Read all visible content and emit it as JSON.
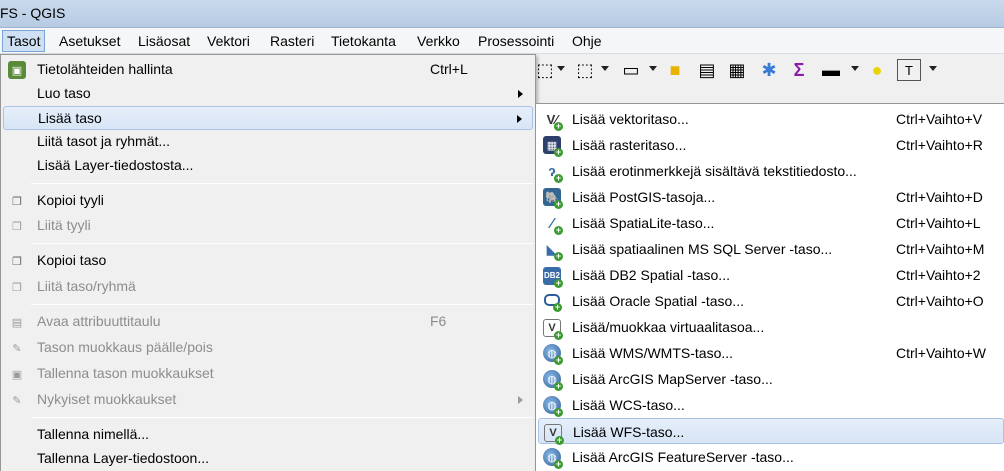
{
  "window": {
    "title": "FS - QGIS"
  },
  "menubar": {
    "items": [
      {
        "label": "Tasot",
        "active": true
      },
      {
        "label": "Asetukset"
      },
      {
        "label": "Lisäosat"
      },
      {
        "label": "Vektori"
      },
      {
        "label": "Rasteri"
      },
      {
        "label": "Tietokanta"
      },
      {
        "label": "Verkko"
      },
      {
        "label": "Prosessointi"
      },
      {
        "label": "Ohje"
      }
    ]
  },
  "main_menu": {
    "items": [
      {
        "label": "Tietolähteiden hallinta",
        "shortcut": "Ctrl+L",
        "icon": "data-source-manager-icon"
      },
      {
        "label": "Luo taso",
        "submenu": true
      },
      {
        "label": "Lisää taso",
        "submenu": true,
        "highlighted": true
      },
      {
        "label": "Liitä tasot ja ryhmät..."
      },
      {
        "label": "Lisää Layer-tiedostosta..."
      },
      {
        "label": "Kopioi tyyli",
        "icon": "copy-style-icon"
      },
      {
        "label": "Liitä tyyli",
        "disabled": true,
        "icon": "paste-style-icon"
      },
      {
        "label": "Kopioi taso",
        "icon": "copy-layer-icon"
      },
      {
        "label": "Liitä taso/ryhmä",
        "disabled": true,
        "icon": "paste-layer-icon"
      },
      {
        "label": "Avaa attribuuttitaulu",
        "shortcut": "F6",
        "disabled": true,
        "icon": "attribute-table-icon"
      },
      {
        "label": "Tason muokkaus päälle/pois",
        "disabled": true,
        "icon": "pencil-icon"
      },
      {
        "label": "Tallenna tason muokkaukset",
        "disabled": true,
        "icon": "save-edits-icon"
      },
      {
        "label": "Nykyiset muokkaukset",
        "disabled": true,
        "submenu": true,
        "icon": "current-edits-icon"
      },
      {
        "label": "Tallenna nimellä..."
      },
      {
        "label": "Tallenna Layer-tiedostoon..."
      }
    ]
  },
  "sub_menu": {
    "items": [
      {
        "label": "Lisää vektoritaso...",
        "shortcut": "Ctrl+Vaihto+V",
        "icon": "vector-layer-icon"
      },
      {
        "label": "Lisää rasteritaso...",
        "shortcut": "Ctrl+Vaihto+R",
        "icon": "raster-layer-icon"
      },
      {
        "label": "Lisää erotinmerkkejä sisältävä tekstitiedosto...",
        "shortcut": "",
        "icon": "delimited-text-icon"
      },
      {
        "label": "Lisää PostGIS-tasoja...",
        "shortcut": "Ctrl+Vaihto+D",
        "icon": "postgis-icon"
      },
      {
        "label": "Lisää SpatiaLite-taso...",
        "shortcut": "Ctrl+Vaihto+L",
        "icon": "spatialite-icon"
      },
      {
        "label": "Lisää spatiaalinen MS SQL Server -taso...",
        "shortcut": "Ctrl+Vaihto+M",
        "icon": "mssql-icon"
      },
      {
        "label": "Lisää DB2 Spatial -taso...",
        "shortcut": "Ctrl+Vaihto+2",
        "icon": "db2-icon"
      },
      {
        "label": "Lisää Oracle Spatial -taso...",
        "shortcut": "Ctrl+Vaihto+O",
        "icon": "oracle-icon"
      },
      {
        "label": "Lisää/muokkaa virtuaalitasoa...",
        "shortcut": "",
        "icon": "virtual-layer-icon"
      },
      {
        "label": "Lisää WMS/WMTS-taso...",
        "shortcut": "Ctrl+Vaihto+W",
        "icon": "wms-icon"
      },
      {
        "label": "Lisää ArcGIS MapServer -taso...",
        "shortcut": "",
        "icon": "arcgis-mapserver-icon"
      },
      {
        "label": "Lisää WCS-taso...",
        "shortcut": "",
        "icon": "wcs-icon"
      },
      {
        "label": "Lisää WFS-taso...",
        "shortcut": "",
        "icon": "wfs-icon",
        "highlighted": true
      },
      {
        "label": "Lisää ArcGIS FeatureServer -taso...",
        "shortcut": "",
        "icon": "arcgis-featureserver-icon"
      }
    ]
  },
  "colors": {
    "highlight": "#d7e5f6",
    "highlight_border": "#a8c3e6",
    "disabled_text": "#8d8d8d",
    "titlebar": "#b6cbe3"
  }
}
